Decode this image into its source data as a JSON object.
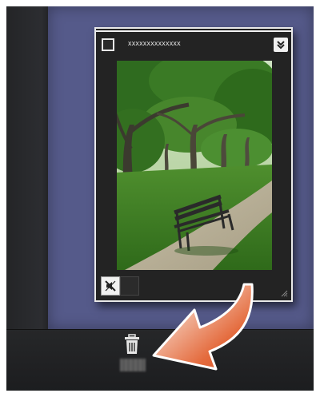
{
  "card": {
    "title": "xxxxxxxxxxxxxx"
  },
  "icons": {
    "expand": "chevron-double-down-icon",
    "mute": "muted-speaker-icon",
    "trash": "trash-icon",
    "resize": "resize-grip-icon"
  },
  "colors": {
    "canvas": "#555a8a",
    "arrow": "#e0562a",
    "card_border": "#e9e9e9"
  }
}
